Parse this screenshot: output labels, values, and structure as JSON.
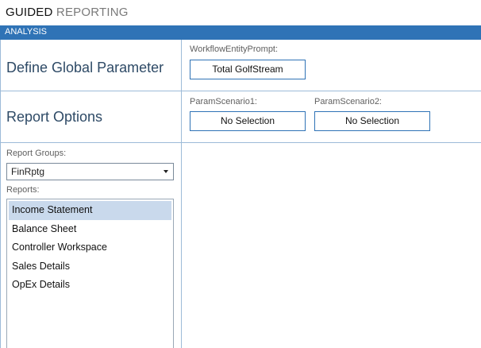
{
  "app": {
    "title_bold": "GUIDED",
    "title_light": "REPORTING"
  },
  "section": {
    "label": "ANALYSIS"
  },
  "global_parameter": {
    "title": "Define Global Parameter",
    "field_label": "WorkflowEntityPrompt:",
    "value": "Total GolfStream"
  },
  "report_options": {
    "title": "Report Options",
    "params": [
      {
        "label": "ParamScenario1:",
        "value": "No Selection"
      },
      {
        "label": "ParamScenario2:",
        "value": "No Selection"
      }
    ]
  },
  "report_groups": {
    "label": "Report Groups:",
    "selected": "FinRptg"
  },
  "reports": {
    "label": "Reports:",
    "items": [
      "Income Statement",
      "Balance Sheet",
      "Controller Workspace",
      "Sales Details",
      "OpEx Details"
    ],
    "selected_index": 0
  }
}
